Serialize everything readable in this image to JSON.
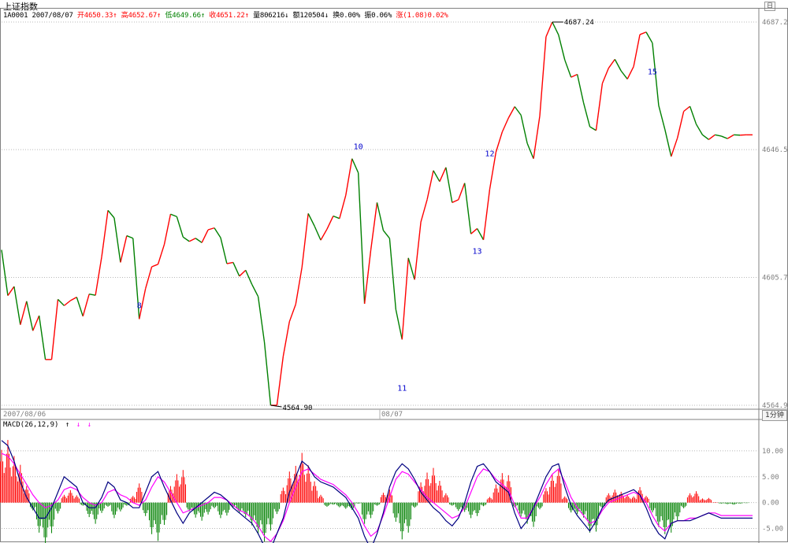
{
  "window": {
    "title": "上证指数",
    "restore_icon": "restore-icon",
    "restore_glyph": "日"
  },
  "info_bar": {
    "code": "1A0001",
    "date": "2007/08/07",
    "open": "开4650.33↑",
    "high": "高4652.67↑",
    "low": "低4649.66↑",
    "close": "收4651.22↑",
    "volume": "量806216↓",
    "amount": "额120504↓",
    "turnover": "换0.00%",
    "amplitude": "振0.06%",
    "change": "涨(1.08)0.02%"
  },
  "x_axis": {
    "date_left": "2007/08/06",
    "date_mid": "08/07",
    "period": "1分钟"
  },
  "macd": {
    "label": "MACD(26,12,9)",
    "arrow_up": "↑",
    "arrow_down_1": "↓",
    "arrow_down_2": "↓"
  },
  "colors": {
    "up": "#ff0000",
    "down": "#008000",
    "wave_label": "#0000cc",
    "dif_line": "#000080",
    "dea_line": "#ff00ff",
    "grid": "#b8b8b8"
  },
  "chart_data": [
    {
      "type": "line",
      "name": "price",
      "segment_colors": "red = rising segment, green = falling segment",
      "ylim": [
        4564.9,
        4687.2
      ],
      "y_ticks": [
        "4687.2",
        "4646.5",
        "4605.7",
        "4564.9"
      ],
      "grid": true,
      "x": [
        0,
        2,
        4,
        6,
        8,
        10,
        12,
        14,
        16,
        18,
        20,
        22,
        24,
        26,
        28,
        30,
        32,
        34,
        36,
        38,
        40,
        42,
        44,
        46,
        48,
        50,
        52,
        54,
        56,
        58,
        60,
        62,
        64,
        66,
        68,
        70,
        72,
        74,
        76,
        78,
        80,
        82,
        84,
        86,
        88,
        90,
        92,
        94,
        96,
        98,
        100,
        102,
        104,
        106,
        108,
        110,
        112,
        114,
        116,
        118,
        120,
        122,
        124,
        126,
        128,
        130,
        132,
        134,
        136,
        138,
        140,
        142,
        144,
        146,
        148,
        150,
        152,
        154,
        156,
        158,
        160,
        162,
        164,
        166,
        168,
        170,
        172,
        174,
        176,
        178,
        180,
        182,
        184,
        186,
        188,
        190,
        192,
        194,
        196,
        198,
        200,
        202,
        204,
        206,
        208,
        210,
        212,
        214,
        216,
        218,
        220,
        222,
        224,
        226,
        228,
        230,
        232,
        234,
        236,
        238,
        240
      ],
      "close": [
        4614.5,
        4599.9,
        4602.8,
        4590.6,
        4598.1,
        4588.7,
        4593.5,
        4579.5,
        4579.5,
        4598.7,
        4596.7,
        4598.3,
        4599.4,
        4593.3,
        4600.4,
        4600.0,
        4612.3,
        4627.1,
        4624.7,
        4610.5,
        4619.0,
        4618.2,
        4592.4,
        4602.1,
        4609.1,
        4609.9,
        4616.2,
        4625.9,
        4625.1,
        4618.6,
        4617.2,
        4618.2,
        4616.8,
        4620.9,
        4621.5,
        4618.4,
        4610.1,
        4610.5,
        4606.1,
        4608.0,
        4603.5,
        4599.6,
        4585.0,
        4564.9,
        4564.9,
        4580.5,
        4591.6,
        4597.1,
        4608.9,
        4626.1,
        4622.1,
        4617.6,
        4621.1,
        4625.3,
        4624.5,
        4631.9,
        4643.6,
        4639.1,
        4597.3,
        4614.4,
        4629.6,
        4620.7,
        4618.2,
        4595.5,
        4585.9,
        4611.9,
        4605.0,
        4623.4,
        4630.5,
        4639.8,
        4636.3,
        4640.8,
        4629.6,
        4630.5,
        4635.8,
        4619.6,
        4621.3,
        4617.7,
        4633.8,
        4645.7,
        4652.1,
        4656.6,
        4660.2,
        4657.5,
        4648.5,
        4643.6,
        4657.2,
        4682.5,
        4687.2,
        4683.1,
        4675.1,
        4669.6,
        4670.5,
        4661.4,
        4653.8,
        4652.6,
        4667.6,
        4672.5,
        4675.3,
        4671.6,
        4669.0,
        4673.0,
        4683.2,
        4684.0,
        4680.5,
        4660.6,
        4652.9,
        4644.3,
        4650.2,
        4658.7,
        4660.3,
        4654.6,
        4651.2,
        4649.7,
        4651.2,
        4650.8,
        4650.0,
        4651.2,
        4651.1,
        4651.2,
        4651.2
      ]
    },
    {
      "type": "bar",
      "name": "MACD",
      "ylim": [
        -7.5,
        15
      ],
      "y_ticks": [
        "10.00",
        "5.00",
        "0.00",
        "-5.00"
      ],
      "grid": true,
      "values": [
        10.2,
        12.1,
        9.0,
        7.3,
        3.2,
        -1.5,
        -5.8,
        -8.6,
        -5.9,
        -2.1,
        1.5,
        2.4,
        1.4,
        -0.6,
        -2.8,
        -4.1,
        -2.0,
        -0.8,
        -3.0,
        -1.7,
        -0.6,
        1.3,
        3.7,
        -2.6,
        -6.1,
        -7.4,
        -4.3,
        3.2,
        5.5,
        6.3,
        -1.7,
        -2.9,
        -3.5,
        -2.3,
        -1.1,
        -3.0,
        -2.5,
        -0.9,
        -2.0,
        -2.8,
        -4.4,
        -6.1,
        -7.5,
        -5.4,
        -2.2,
        2.9,
        6.0,
        7.1,
        9.6,
        7.2,
        4.1,
        1.5,
        -0.8,
        -0.4,
        -0.9,
        -1.2,
        -1.4,
        -0.2,
        -4.1,
        -3.0,
        -0.6,
        1.9,
        2.5,
        -3.7,
        -7.1,
        -5.8,
        -1.0,
        3.9,
        5.8,
        6.7,
        4.2,
        1.8,
        -0.6,
        -1.6,
        -1.8,
        -3.0,
        -2.6,
        -0.7,
        1.1,
        3.5,
        5.7,
        5.3,
        -0.9,
        -2.7,
        -4.1,
        -4.7,
        -1.3,
        2.8,
        5.4,
        6.6,
        1.2,
        -1.9,
        -2.2,
        -2.9,
        -5.8,
        -5.6,
        -1.1,
        1.8,
        2.5,
        2.1,
        1.5,
        1.2,
        3.0,
        1.3,
        -1.9,
        -4.7,
        -6.1,
        -5.8,
        -3.4,
        -1.1,
        1.8,
        2.2,
        0.8,
        0.9,
        0.1,
        -0.2,
        -0.3,
        -0.4,
        -0.2,
        -0.1,
        0.0
      ]
    },
    {
      "type": "line",
      "name": "DIF",
      "values": [
        12.0,
        11.0,
        8.0,
        4.0,
        1.0,
        -1.0,
        -3.0,
        -3.0,
        -1.0,
        2.0,
        5.0,
        4.0,
        3.0,
        0.0,
        -1.0,
        -1.0,
        1.0,
        4.0,
        3.0,
        0.5,
        0.0,
        -1.0,
        -1.0,
        2.0,
        5.0,
        6.0,
        3.0,
        0.5,
        -2.0,
        -4.0,
        -2.0,
        -1.0,
        0.0,
        1.0,
        2.0,
        1.5,
        0.5,
        -1.0,
        -2.0,
        -3.0,
        -4.0,
        -6.0,
        -8.5,
        -9.0,
        -6.0,
        -3.0,
        2.0,
        5.0,
        8.0,
        7.0,
        5.0,
        4.0,
        3.5,
        3.0,
        2.0,
        1.0,
        -1.0,
        -3.0,
        -6.5,
        -9.0,
        -6.0,
        -2.0,
        3.0,
        6.0,
        7.5,
        6.5,
        4.5,
        2.0,
        0.5,
        -1.0,
        -2.0,
        -3.5,
        -4.5,
        -3.0,
        0.0,
        4.0,
        7.0,
        7.5,
        6.0,
        4.0,
        3.0,
        2.0,
        -2.0,
        -5.0,
        -3.5,
        -1.0,
        2.0,
        5.0,
        7.0,
        7.5,
        3.0,
        -0.5,
        -2.5,
        -4.0,
        -5.5,
        -3.5,
        -1.0,
        0.5,
        1.0,
        1.5,
        2.0,
        2.5,
        1.5,
        -1.0,
        -4.0,
        -6.0,
        -7.0,
        -4.0,
        -3.5,
        -3.5,
        -3.5,
        -3.0,
        -2.5,
        -2.0,
        -2.5,
        -3.0,
        -3.0,
        -3.0,
        -3.0,
        -3.0,
        -3.0
      ]
    },
    {
      "type": "line",
      "name": "DEA",
      "values": [
        9.5,
        9.0,
        7.5,
        5.5,
        3.5,
        1.5,
        0.0,
        -1.0,
        -0.5,
        0.5,
        2.5,
        3.0,
        2.5,
        1.0,
        0.0,
        -0.5,
        0.0,
        2.0,
        2.5,
        1.5,
        1.0,
        0.0,
        -0.5,
        0.5,
        3.0,
        5.0,
        4.0,
        2.0,
        0.0,
        -2.0,
        -1.5,
        -1.0,
        -0.5,
        0.0,
        1.0,
        1.0,
        0.5,
        -0.5,
        -1.5,
        -2.0,
        -3.0,
        -4.5,
        -6.5,
        -7.5,
        -6.0,
        -3.5,
        0.0,
        3.0,
        6.0,
        6.5,
        5.5,
        4.5,
        4.0,
        3.5,
        2.5,
        1.5,
        0.0,
        -2.0,
        -4.5,
        -6.5,
        -5.5,
        -2.5,
        1.0,
        4.5,
        6.0,
        5.5,
        4.0,
        2.5,
        1.0,
        0.0,
        -1.0,
        -2.0,
        -3.0,
        -2.5,
        -1.0,
        2.0,
        5.0,
        6.5,
        6.0,
        4.5,
        3.5,
        2.5,
        -0.5,
        -3.0,
        -3.0,
        -1.0,
        1.0,
        3.5,
        5.5,
        6.5,
        4.0,
        1.0,
        -1.0,
        -2.5,
        -4.0,
        -3.5,
        -1.5,
        0.0,
        0.5,
        1.0,
        1.5,
        2.0,
        1.5,
        0.0,
        -2.5,
        -4.5,
        -5.5,
        -4.0,
        -3.5,
        -3.5,
        -3.0,
        -3.0,
        -2.5,
        -2.0,
        -2.0,
        -2.5,
        -2.5,
        -2.5,
        -2.5,
        -2.5,
        -2.5
      ]
    }
  ],
  "annotations": {
    "price_max": "4687.24",
    "price_min": "4564.90",
    "wave_8": "8",
    "wave_10": "10",
    "wave_11": "11",
    "wave_12": "12",
    "wave_13": "13",
    "wave_15": "15"
  }
}
